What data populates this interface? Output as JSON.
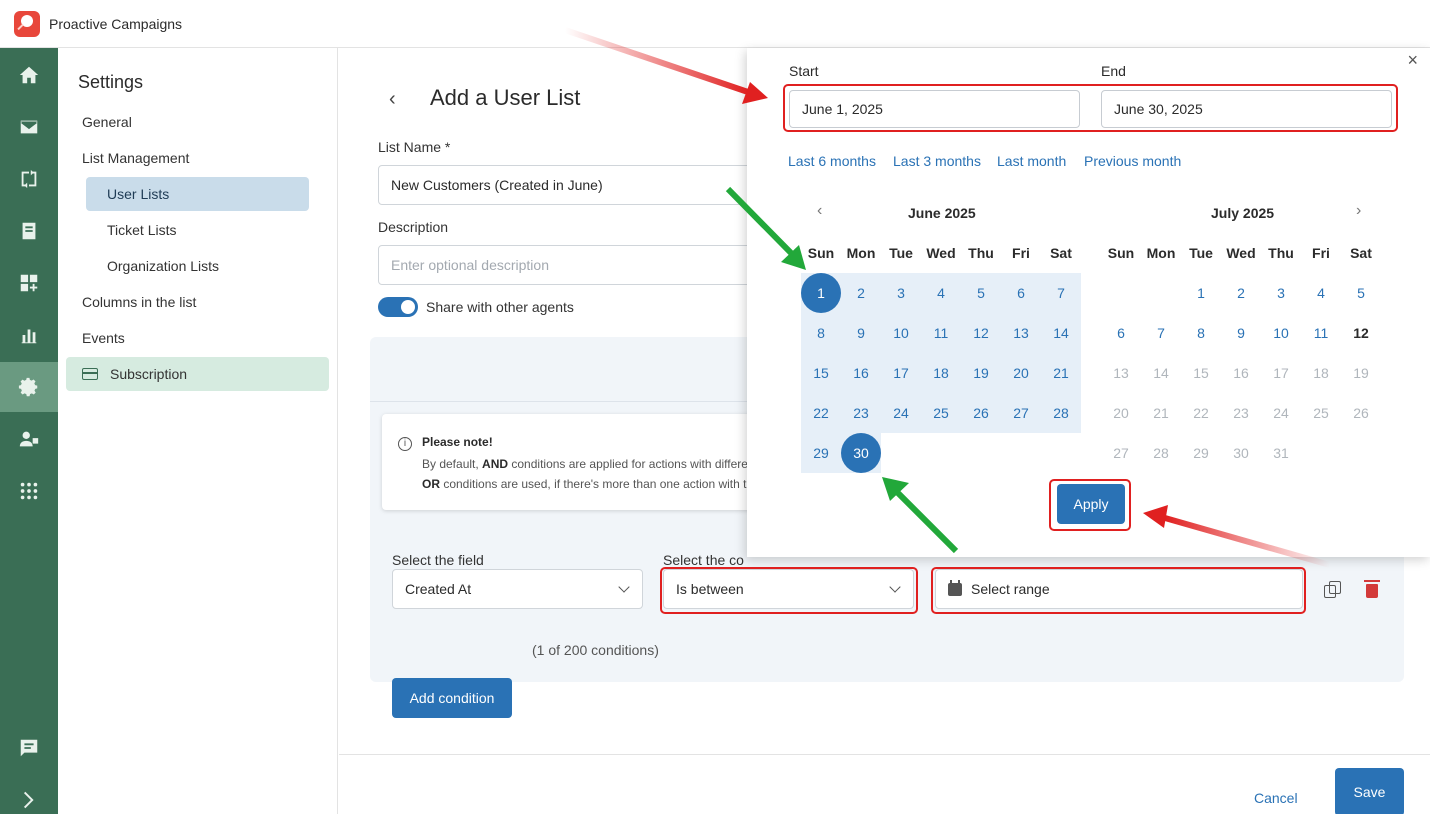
{
  "app": {
    "title": "Proactive Campaigns"
  },
  "rail": {
    "icons": [
      "home-icon",
      "mail-icon",
      "sync-icon",
      "inbox-icon",
      "apps-add-icon",
      "chart-icon",
      "settings-icon",
      "user-lock-icon",
      "grid-icon",
      "chat-icon",
      "chevron-right-icon"
    ]
  },
  "sidenav": {
    "title": "Settings",
    "general": "General",
    "list_management": "List Management",
    "user_lists": "User Lists",
    "ticket_lists": "Ticket Lists",
    "organization_lists": "Organization Lists",
    "columns": "Columns in the list",
    "events": "Events",
    "subscription": "Subscription"
  },
  "form": {
    "title": "Add a User List",
    "list_name_label": "List Name *",
    "list_name_value": "New Customers (Created in June)",
    "description_label": "Description",
    "description_placeholder": "Enter optional description",
    "share_label": "Share with other agents"
  },
  "note": {
    "title": "Please note!",
    "line1_pre": "By default, ",
    "line1_bold": "AND",
    "line1_post": " conditions are applied for actions with differe",
    "line2_bold": "OR",
    "line2_post": " conditions are used, if there's more than one action with t"
  },
  "condition": {
    "field_label": "Select the field",
    "condition_label": "Select the co",
    "field_value": "Created At",
    "operator_value": "Is between",
    "range_placeholder": "Select range",
    "add_button": "Add condition",
    "count": "(1 of 200 conditions)"
  },
  "footer": {
    "cancel": "Cancel",
    "save": "Save"
  },
  "datepicker": {
    "close": "×",
    "start_label": "Start",
    "end_label": "End",
    "start_value": "June 1, 2025",
    "end_value": "June 30, 2025",
    "presets": [
      "Last 6 months",
      "Last 3 months",
      "Last month",
      "Previous month"
    ],
    "prev": "‹",
    "next": "›",
    "dows": [
      "Sun",
      "Mon",
      "Tue",
      "Wed",
      "Thu",
      "Fri",
      "Sat"
    ],
    "months": [
      {
        "title": "June 2025",
        "first_weekday": 0,
        "days": 30
      },
      {
        "title": "July 2025",
        "first_weekday": 2,
        "days": 31
      }
    ],
    "range_start": 1,
    "range_end": 30,
    "today": 12,
    "apply": "Apply"
  },
  "colors": {
    "accent": "#2a72b5",
    "rail": "#3a6e55",
    "annotation_red": "#e02020",
    "annotation_green": "#22a83a"
  }
}
